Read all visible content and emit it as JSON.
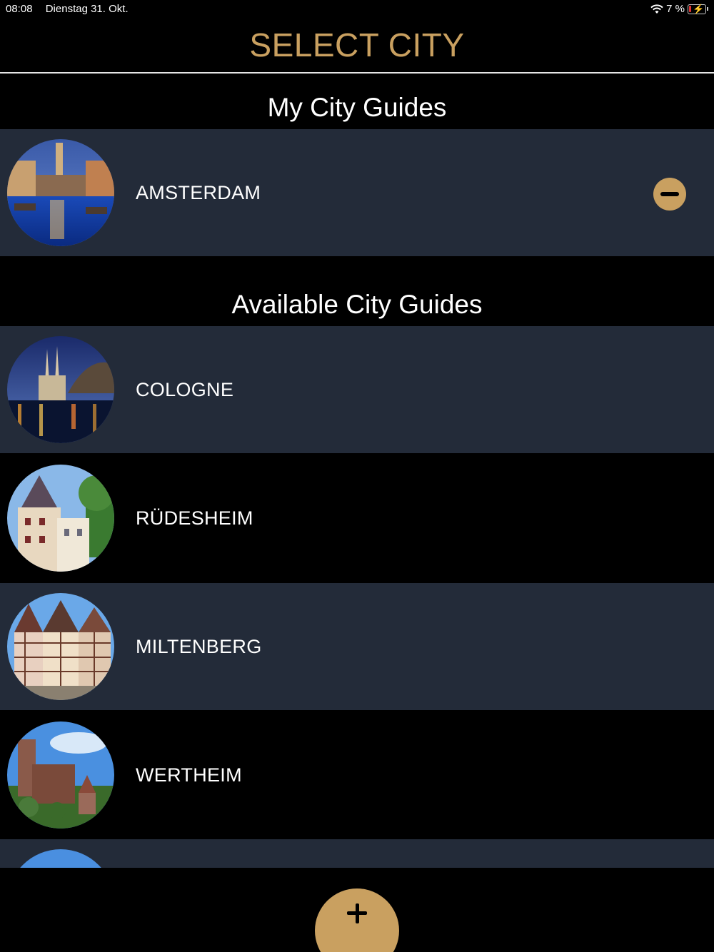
{
  "status_bar": {
    "time": "08:08",
    "date": "Dienstag 31. Okt.",
    "battery": "7 %"
  },
  "header": {
    "title": "SELECT CITY"
  },
  "sections": {
    "my": "My City Guides",
    "available": "Available City Guides"
  },
  "my_cities": [
    {
      "name": "AMSTERDAM"
    }
  ],
  "available_cities": [
    {
      "name": "COLOGNE"
    },
    {
      "name": "RÜDESHEIM"
    },
    {
      "name": "MILTENBERG"
    },
    {
      "name": "WERTHEIM"
    }
  ],
  "colors": {
    "accent": "#c9a060",
    "row_shade": "#232b39",
    "background": "#000000"
  },
  "icons": {
    "remove": "minus-circle-icon",
    "add": "plus-icon",
    "wifi": "wifi-icon",
    "battery": "battery-charging-icon"
  }
}
